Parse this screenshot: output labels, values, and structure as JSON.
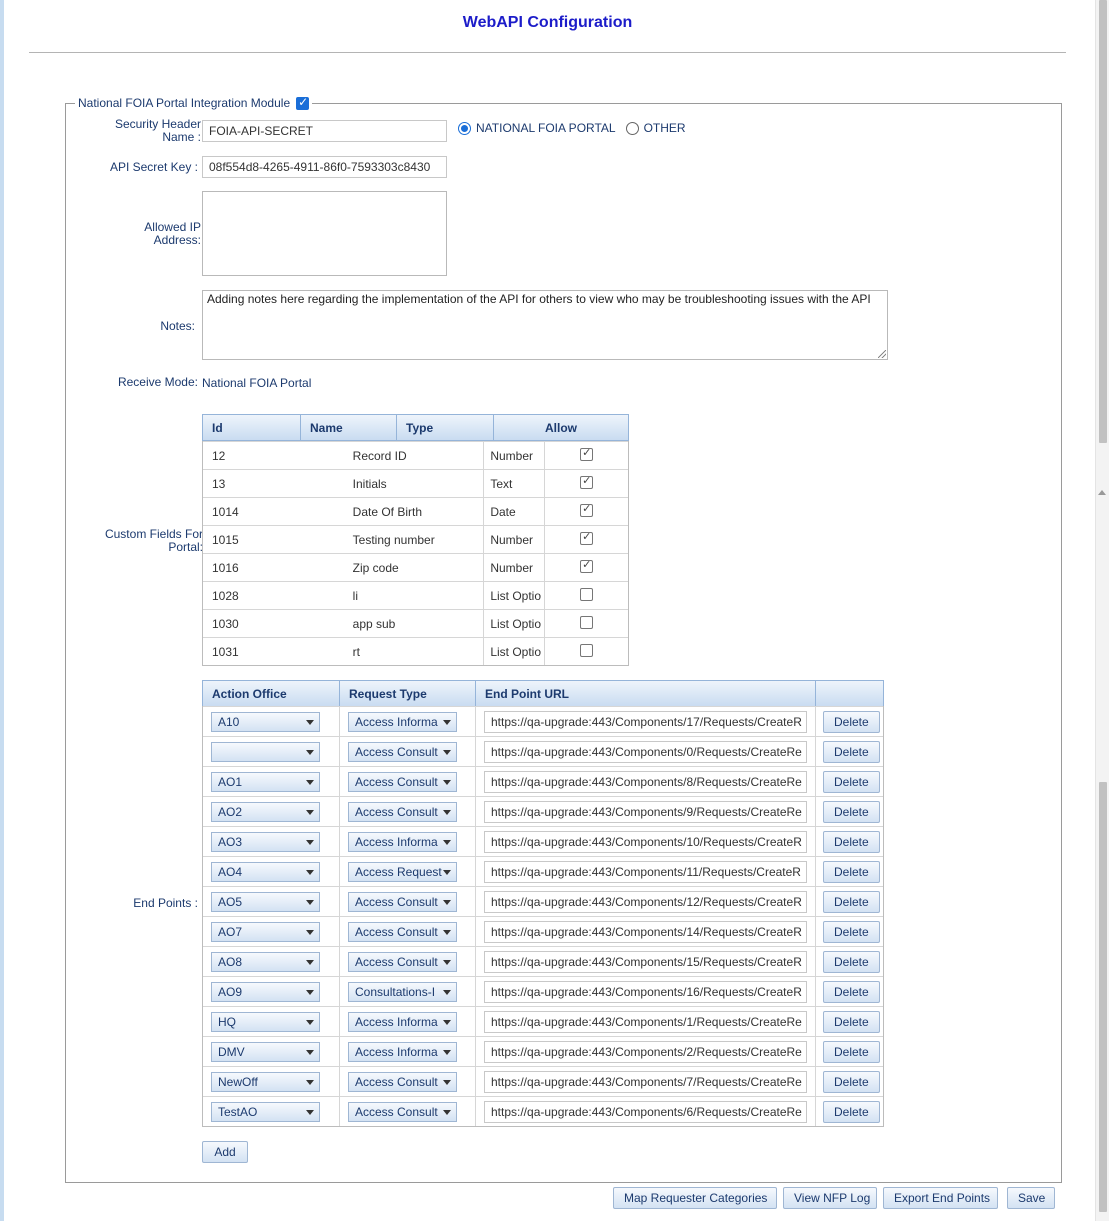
{
  "page": {
    "title": "WebAPI Configuration"
  },
  "module": {
    "legend": "National FOIA Portal Integration Module",
    "enabled": true
  },
  "security_header": {
    "label_line1": "Security Header",
    "label_line2": "Name :",
    "value": "FOIA-API-SECRET"
  },
  "portal_type": {
    "options": [
      {
        "label": "NATIONAL FOIA PORTAL",
        "selected": true
      },
      {
        "label": "OTHER",
        "selected": false
      }
    ]
  },
  "api_secret": {
    "label": "API Secret Key :",
    "value": "08f554d8-4265-4911-86f0-7593303c8430"
  },
  "allowed_ip": {
    "label_line1": "Allowed IP",
    "label_line2": "Address:",
    "value": ""
  },
  "notes": {
    "label": "Notes:",
    "value": "Adding notes here regarding the implementation of the API for others to view who may be troubleshooting issues with the API"
  },
  "receive_mode": {
    "label": "Receive Mode:",
    "value": "National FOIA Portal"
  },
  "custom_fields": {
    "label_line1": "Custom Fields For",
    "label_line2": "Portal:",
    "headers": [
      "Id",
      "Name",
      "Type",
      "Allow"
    ],
    "rows": [
      {
        "id": "12",
        "name": "Record ID",
        "type": "Number",
        "allow": true
      },
      {
        "id": "13",
        "name": "Initials",
        "type": "Text",
        "allow": true
      },
      {
        "id": "1014",
        "name": "Date Of Birth",
        "type": "Date",
        "allow": true
      },
      {
        "id": "1015",
        "name": "Testing number",
        "type": "Number",
        "allow": true
      },
      {
        "id": "1016",
        "name": "Zip code",
        "type": "Number",
        "allow": true
      },
      {
        "id": "1028",
        "name": "li",
        "type": "List Optio",
        "allow": false
      },
      {
        "id": "1030",
        "name": "app sub",
        "type": "List Optio",
        "allow": false
      },
      {
        "id": "1031",
        "name": "rt",
        "type": "List Optio",
        "allow": false
      }
    ]
  },
  "end_points": {
    "label": "End Points :",
    "headers": [
      "Action Office",
      "Request Type",
      "End Point URL",
      ""
    ],
    "delete_label": "Delete",
    "rows": [
      {
        "office": "A10",
        "request_type": "Access Informa",
        "url": "https://qa-upgrade:443/Components/17/Requests/CreateR"
      },
      {
        "office": "",
        "request_type": "Access Consult",
        "url": "https://qa-upgrade:443/Components/0/Requests/CreateRe"
      },
      {
        "office": "AO1",
        "request_type": "Access Consult",
        "url": "https://qa-upgrade:443/Components/8/Requests/CreateRe"
      },
      {
        "office": "AO2",
        "request_type": "Access Consult",
        "url": "https://qa-upgrade:443/Components/9/Requests/CreateRe"
      },
      {
        "office": "AO3",
        "request_type": "Access Informa",
        "url": "https://qa-upgrade:443/Components/10/Requests/CreateR"
      },
      {
        "office": "AO4",
        "request_type": "Access Request",
        "url": "https://qa-upgrade:443/Components/11/Requests/CreateR"
      },
      {
        "office": "AO5",
        "request_type": "Access Consult",
        "url": "https://qa-upgrade:443/Components/12/Requests/CreateR"
      },
      {
        "office": "AO7",
        "request_type": "Access Consult",
        "url": "https://qa-upgrade:443/Components/14/Requests/CreateR"
      },
      {
        "office": "AO8",
        "request_type": "Access Consult",
        "url": "https://qa-upgrade:443/Components/15/Requests/CreateR"
      },
      {
        "office": "AO9",
        "request_type": "Consultations-I",
        "url": "https://qa-upgrade:443/Components/16/Requests/CreateR"
      },
      {
        "office": "HQ",
        "request_type": "Access Informa",
        "url": "https://qa-upgrade:443/Components/1/Requests/CreateRe"
      },
      {
        "office": "DMV",
        "request_type": "Access Informa",
        "url": "https://qa-upgrade:443/Components/2/Requests/CreateRe"
      },
      {
        "office": "NewOff",
        "request_type": "Access Consult",
        "url": "https://qa-upgrade:443/Components/7/Requests/CreateRe"
      },
      {
        "office": "TestAO",
        "request_type": "Access Consult",
        "url": "https://qa-upgrade:443/Components/6/Requests/CreateRe"
      }
    ],
    "add_label": "Add"
  },
  "footer_buttons": {
    "map_requester": "Map Requester Categories",
    "view_log": "View NFP Log",
    "export": "Export End Points",
    "save": "Save"
  },
  "colors": {
    "title": "#1c1cc9",
    "label": "#1c3a6e",
    "grid_header": "#c9dcf1",
    "accent": "#1a6ed8"
  }
}
